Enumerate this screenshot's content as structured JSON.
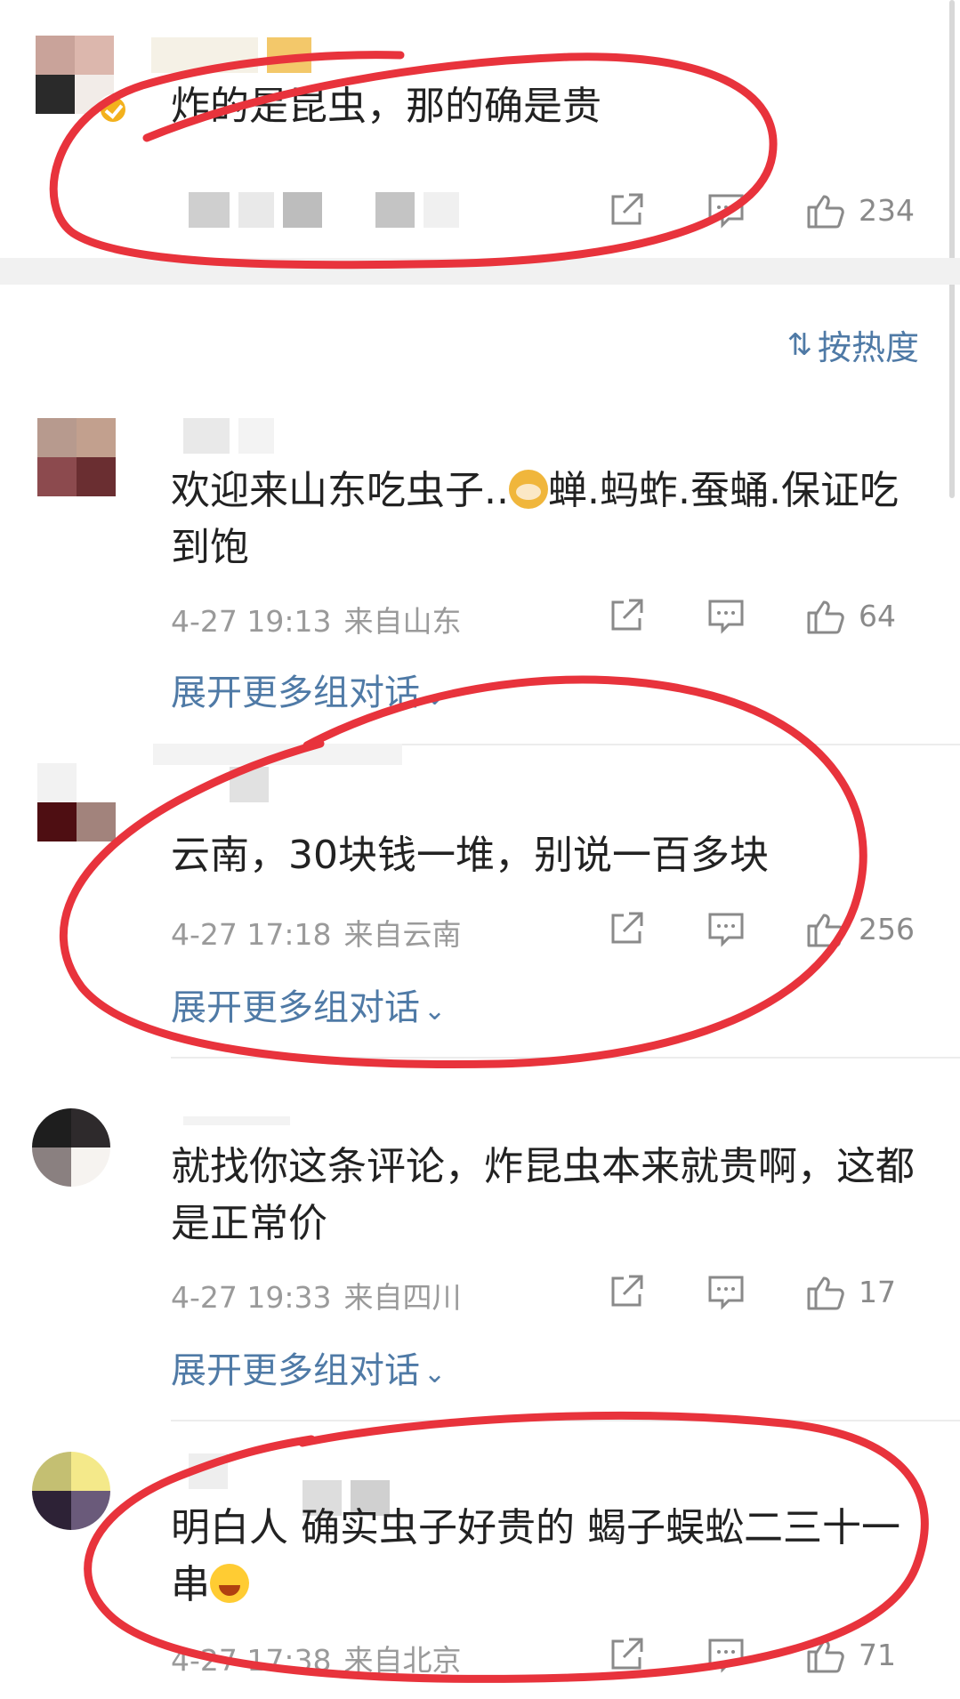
{
  "sort_label": "按热度",
  "expand_label": "展开更多组对话",
  "top_comment": {
    "text": "炸的是昆虫，那的确是贵",
    "likes": "234"
  },
  "comments": [
    {
      "text": "欢迎来山东吃虫子..",
      "text_after_emoji": "蝉.蚂蚱.蚕蛹.保证吃到饱",
      "emoji": "doge-emoji",
      "time": "4-27 19:13",
      "location": "来自山东",
      "likes": "64"
    },
    {
      "text": "云南，30块钱一堆，别说一百多块",
      "time": "4-27 17:18",
      "location": "来自云南",
      "likes": "256"
    },
    {
      "text": "就找你这条评论，炸昆虫本来就贵啊，这都是正常价",
      "time": "4-27 19:33",
      "location": "来自四川",
      "likes": "17"
    },
    {
      "text": "明白人 确实虫子好贵的 蝎子蜈蚣二三十一串",
      "emoji": "laughing-tears-emoji",
      "time": "4-27 17:38",
      "location": "来自北京",
      "likes": "71"
    }
  ],
  "colors": {
    "link": "#4f7aa6",
    "meta": "#9a9a9a",
    "annotation": "#e8333c"
  }
}
